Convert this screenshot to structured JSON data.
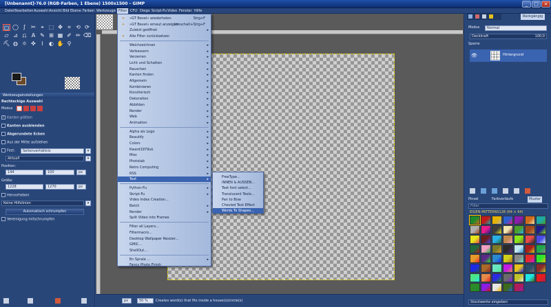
{
  "window": {
    "title": "[Unbenannt]-76.0 (RGB-Farben, 1 Ebene) 1500x1500 – GIMP",
    "controls": [
      "_",
      "□",
      "×"
    ]
  },
  "menubar": [
    "Datei",
    "Bearbeiten",
    "Auswahl",
    "Ansicht",
    "Bild",
    "Ebene",
    "Farben",
    "Werkzeuge",
    "Filter",
    "CFU",
    "Diego",
    "Script-Fu",
    "Video",
    "Fenster",
    "Hilfe"
  ],
  "toolbox": {
    "tool_glyphs": [
      "▢",
      "◯",
      "ʃ",
      "✂",
      "⌖",
      "⬚",
      "✥",
      "⌗",
      "⟲",
      "⟳",
      "▱",
      "⊿",
      "⎌",
      "A",
      "✎",
      "⊞",
      "▦",
      "✐",
      "✏",
      "⌫",
      "⛏",
      "◍",
      "☼",
      "✜",
      "⌇",
      "◐",
      "✋",
      "⚲"
    ],
    "options_tab": "Werkzeugeinstellungen",
    "tool_name": "Rechteckige Auswahl",
    "mode_label": "Modus",
    "antialias": "Kanten glätten",
    "feather": "Kanten ausblenden",
    "rounded": "Abgerundete Ecken",
    "from_center": "Aus der Mitte aufziehen",
    "fixed_label": "Fest:",
    "fixed_value": "Seitenverhältnis",
    "current": "Aktuell",
    "position_label": "Position:",
    "pos_x": "144",
    "pos_y": "100",
    "unit": "px",
    "size_label": "Größe:",
    "size_w": "1228",
    "size_h": "1270",
    "highlight": "Hervorheben",
    "guides": "Keine Hilfslinien",
    "autoshrink": "Automatisch schrumpfen",
    "shrink_merged": "Vereinigung mitschrumpfen"
  },
  "status": {
    "unit": "px",
    "zoom": "50 %",
    "message": "Creates word(s) that fits inside a house(s)/circle(s)"
  },
  "filter_menu": {
    "top_items": [
      {
        "label": "»GT Bevel« wiederholen",
        "shortcut": "Strg+F"
      },
      {
        "label": "»GT Bevel« erneut anzeigen",
        "shortcut": "Umschalt+Strg+F"
      },
      {
        "label": "Zuletzt geöffnet",
        "arrow": true
      },
      {
        "label": "Alle Filter zurücksetzen"
      }
    ],
    "group1": [
      "Weichzeichnen",
      "Verbessern",
      "Verzerren",
      "Licht und Schatten",
      "Rauschen",
      "Kanten finden",
      "Allgemein",
      "Kombinieren",
      "Künstlerisch",
      "Dekoration",
      "Abbilden",
      "Render",
      "Web",
      "Animation"
    ],
    "group2": [
      "Alpha als Logo",
      "Beautify",
      "Colors",
      "Kward1979uk",
      "Misc",
      "Photolab",
      "Retro Computing",
      "RSS",
      "Text"
    ],
    "group3": [
      "Python-Fu",
      "Skript-Fu",
      "Video Index Creation...",
      "Batch",
      "Render",
      "Split Video into Frames"
    ],
    "group4": [
      "Filter all Layers...",
      "Filtermacro...",
      "Desktop Wallpaper Resizer...",
      "GMIC...",
      "ShellOut..."
    ],
    "group5": [
      "En Sprale ...",
      "Fancy Photo Finish"
    ]
  },
  "text_submenu": [
    "FreeType...",
    "INNEN & AUSSEN...",
    "Text font select...",
    "Translucent Texts...",
    "Pan to Bow",
    "Chevied Text Effect",
    "Words To Shapes..."
  ],
  "right_dock": {
    "undo_tab": "Rückgängig",
    "mode_label": "Modus",
    "mode_value": "Normal",
    "opacity_label": "Deckkraft",
    "opacity_value": "100,0",
    "lock_label": "Sperre",
    "layer_name": "Hintergrund",
    "brush_tab": "Pinsel",
    "gradient_tab": "Farbverläufe",
    "pattern_tab": "Muster",
    "filter_placeholder": "Filter",
    "pattern_set": "EIGEN-PATTERNS128 (64 × 64)",
    "pattern_name": "Stockwerke eingeben",
    "pattern_colors": [
      "#1c8a2a",
      "#c21a1a",
      "#e6b400",
      "#2a5fd0",
      "#8d1cb0",
      "#d06a1c",
      "#1ca8a8",
      "#b0b0b0",
      "#e61c8a",
      "#3d3d3d",
      "#f2e6b0",
      "#4aa02a",
      "#a0461c",
      "#1c1c8a",
      "#e6e61c",
      "#6a1c1c",
      "#2ab0e6",
      "#c28a4a",
      "#8ae61c",
      "#e64a4a",
      "#4a4ae6",
      "#1c6a3d",
      "#f2a0c2",
      "#7a7a2a",
      "#2a2a2a",
      "#c2e6f2",
      "#a81c1c",
      "#1ca84a",
      "#e69a2a",
      "#5a2a8a",
      "#2a8ad0",
      "#d0d01c",
      "#8a8a8a",
      "#e62a2a",
      "#2ae62a",
      "#1c2ae6",
      "#aa6a2a",
      "#6ae6c2",
      "#c21ce6",
      "#e6c21c",
      "#2a4a6a",
      "#8a2a2a",
      "#4ae68a",
      "#e68a4a",
      "#2a2ae6",
      "#6a6a6a",
      "#c2c22a",
      "#1ce6e6",
      "#e61c1c",
      "#2a8a2a",
      "#8a1ce6",
      "#e6e6e6",
      "#3d6a1c",
      "#b01c5a"
    ]
  }
}
